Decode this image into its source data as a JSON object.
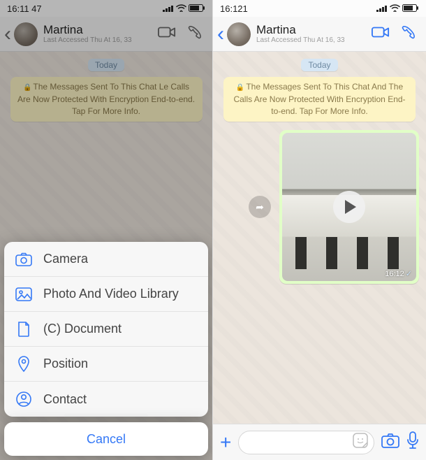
{
  "left": {
    "status": {
      "time": "16:11 47"
    },
    "header": {
      "name": "Martina",
      "sub": "Last Accessed Thu At 16, 33"
    },
    "body": {
      "today": "Today",
      "encryption": "The Messages Sent To This Chat Le Calls Are Now Protected With Encryption End-to-end. Tap For More Info."
    },
    "sheet": {
      "camera": "Camera",
      "library": "Photo And Video Library",
      "document": "(C) Document",
      "position": "Position",
      "contact": "Contact",
      "cancel": "Cancel"
    }
  },
  "right": {
    "status": {
      "time": "16:121"
    },
    "header": {
      "name": "Martina",
      "sub": "Last Accessed Thu At 16, 33"
    },
    "body": {
      "today": "Today",
      "encryption": "The Messages Sent To This Chat And The Calls Are Now Protected With Encryption End-to-end. Tap For More Info.",
      "video_time": "16:12"
    },
    "input": {
      "placeholder": ""
    }
  },
  "colors": {
    "accent": "#3478f6"
  }
}
